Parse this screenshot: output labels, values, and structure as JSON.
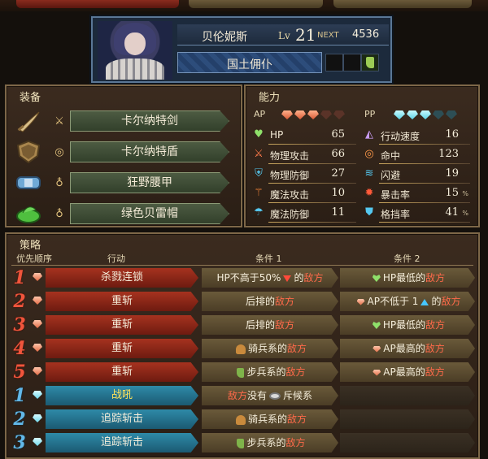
{
  "character": {
    "name": "贝伦妮斯",
    "lv_label": "Lv",
    "level": "21",
    "next_label": "NEXT",
    "next_value": "4536",
    "class_name": "国土佣仆"
  },
  "equipment": {
    "title": "装备",
    "items": [
      {
        "name": "卡尔纳特剑",
        "icon": "sword-icon"
      },
      {
        "name": "卡尔纳特盾",
        "icon": "shield-icon"
      },
      {
        "name": "狂野腰甲",
        "icon": "belt-icon"
      },
      {
        "name": "绿色贝雷帽",
        "icon": "beret-icon"
      }
    ]
  },
  "abilities": {
    "title": "能力",
    "ap_label": "AP",
    "pp_label": "PP",
    "ap_gems": {
      "filled": 3,
      "total": 5
    },
    "pp_gems": {
      "filled": 3,
      "total": 5
    },
    "left_stats": [
      {
        "label": "HP",
        "value": "65",
        "icon": "heart-icon"
      },
      {
        "label": "物理攻击",
        "value": "66",
        "icon": "sword-icon"
      },
      {
        "label": "物理防御",
        "value": "27",
        "icon": "armor-icon"
      },
      {
        "label": "魔法攻击",
        "value": "10",
        "icon": "staff-icon"
      },
      {
        "label": "魔法防御",
        "value": "11",
        "icon": "cloak-icon"
      }
    ],
    "right_stats": [
      {
        "label": "行动速度",
        "value": "16",
        "icon": "speed-icon",
        "pct": ""
      },
      {
        "label": "命中",
        "value": "123",
        "icon": "target-icon",
        "pct": ""
      },
      {
        "label": "闪避",
        "value": "19",
        "icon": "evade-icon",
        "pct": ""
      },
      {
        "label": "暴击率",
        "value": "15",
        "icon": "crit-icon",
        "pct": "%"
      },
      {
        "label": "格挡率",
        "value": "41",
        "icon": "block-icon",
        "pct": "%"
      }
    ]
  },
  "strategy": {
    "title": "策略",
    "headers": {
      "priority": "优先顺序",
      "action": "行动",
      "cond1": "条件 1",
      "cond2": "条件 2"
    },
    "rows": [
      {
        "num": "1",
        "type": "red",
        "action": "杀戮连锁"
      },
      {
        "num": "2",
        "type": "red",
        "action": "重斩"
      },
      {
        "num": "3",
        "type": "red",
        "action": "重斩"
      },
      {
        "num": "4",
        "type": "red",
        "action": "重斩"
      },
      {
        "num": "5",
        "type": "red",
        "action": "重斩"
      },
      {
        "num": "1",
        "type": "blue",
        "action": "战吼"
      },
      {
        "num": "2",
        "type": "blue",
        "action": "追踪斩击"
      },
      {
        "num": "3",
        "type": "blue",
        "action": "追踪斩击"
      }
    ],
    "cond_text": {
      "hp_not_above_50": "HP不高于50%",
      "of": "的",
      "enemy": "敌方",
      "hp_lowest": "HP最低的",
      "rear": "后排的",
      "ap_not_below_1": "AP不低于 1",
      "cavalry": "骑兵系的",
      "infantry": "步兵系的",
      "ap_highest": "AP最高的",
      "enemy_has": "没有",
      "scout": "斥候系"
    }
  }
}
